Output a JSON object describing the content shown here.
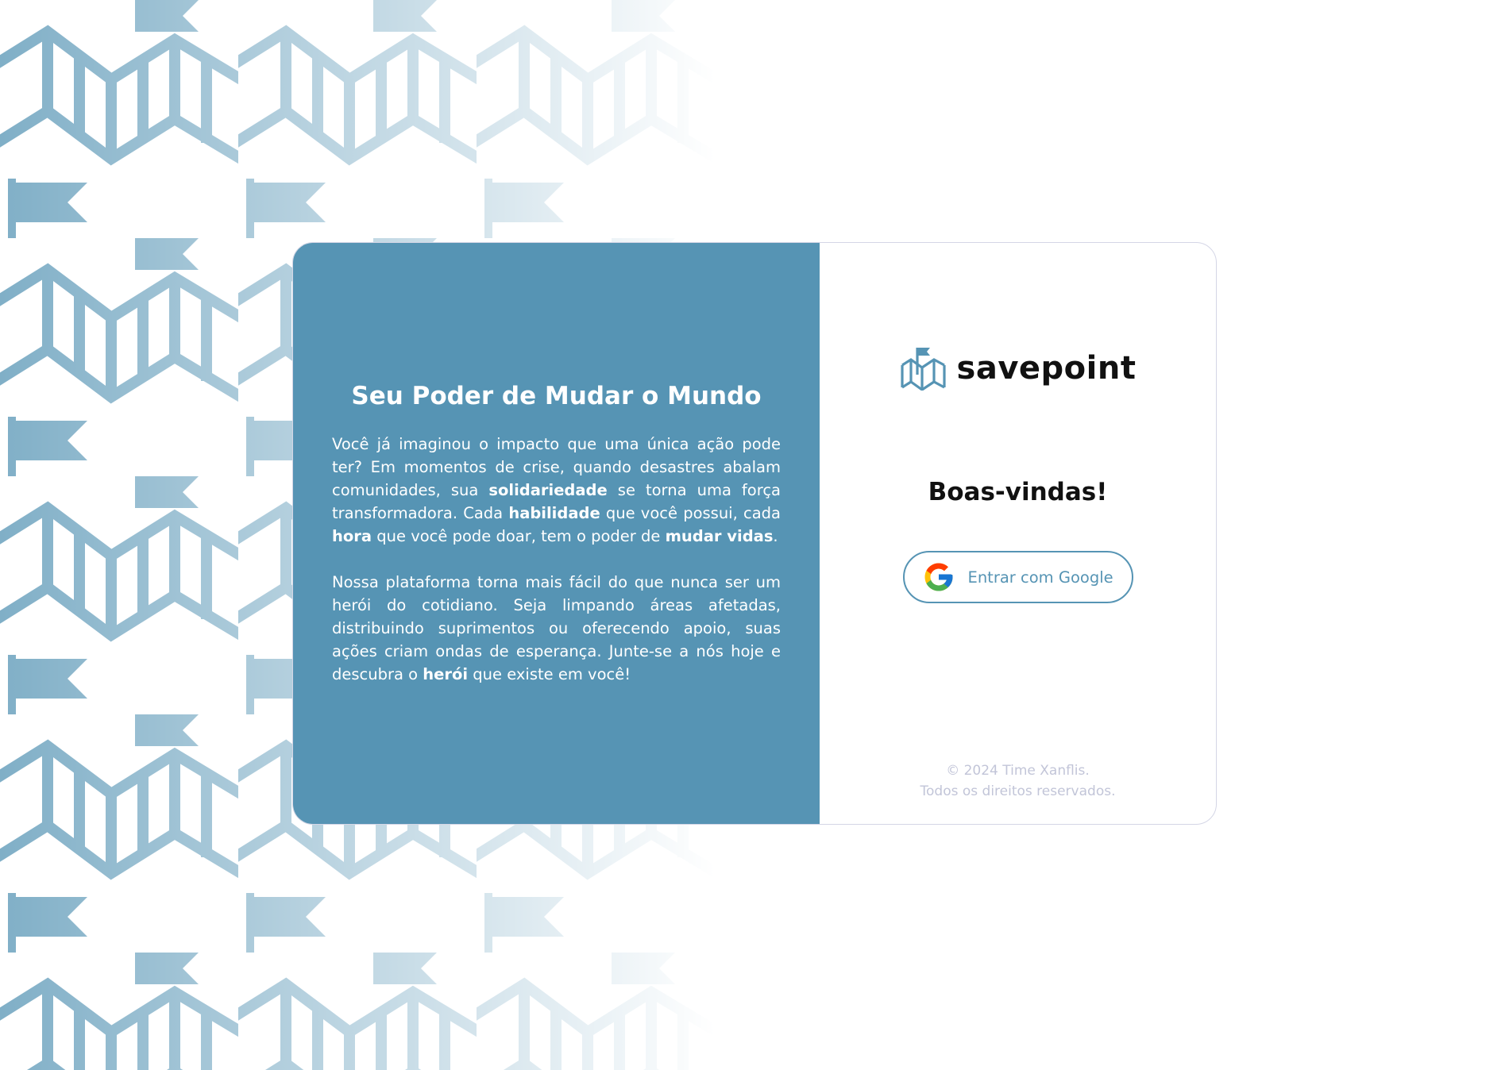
{
  "colors": {
    "brand_blue": "#5694b4",
    "card_border": "#d4d6e6",
    "footer_text": "#c2c5d8",
    "pattern": "#5694b4"
  },
  "intro": {
    "title": "Seu Poder de Mudar o Mundo",
    "p1": [
      {
        "text": "Você já imaginou o impacto que uma única ação pode ter? Em momentos de crise, quando desastres abalam comunidades, sua ",
        "bold": false
      },
      {
        "text": "solidariedade",
        "bold": true
      },
      {
        "text": " se torna uma força transformadora. Cada ",
        "bold": false
      },
      {
        "text": "habilidade",
        "bold": true
      },
      {
        "text": " que você possui, cada ",
        "bold": false
      },
      {
        "text": "hora",
        "bold": true
      },
      {
        "text": " que você pode doar, tem o poder de ",
        "bold": false
      },
      {
        "text": "mudar vidas",
        "bold": true
      },
      {
        "text": ".",
        "bold": false
      }
    ],
    "p2": [
      {
        "text": "Nossa plataforma torna mais fácil do que nunca ser um herói do cotidiano. Seja limpando áreas afetadas, distribuindo suprimentos ou oferecendo apoio, suas ações criam ondas de esperança. Junte-se a nós hoje e descubra o ",
        "bold": false
      },
      {
        "text": "herói",
        "bold": true
      },
      {
        "text": " que existe em você!",
        "bold": false
      }
    ]
  },
  "logo": {
    "icon": "savepoint-logo-icon",
    "text": "savepoint"
  },
  "login": {
    "welcome": "Boas-vindas!",
    "google_button_label": "Entrar com Google",
    "google_icon": "google-icon"
  },
  "footer": {
    "copyright": "© 2024 Time Xanflis.",
    "rights": "Todos os direitos reservados."
  }
}
